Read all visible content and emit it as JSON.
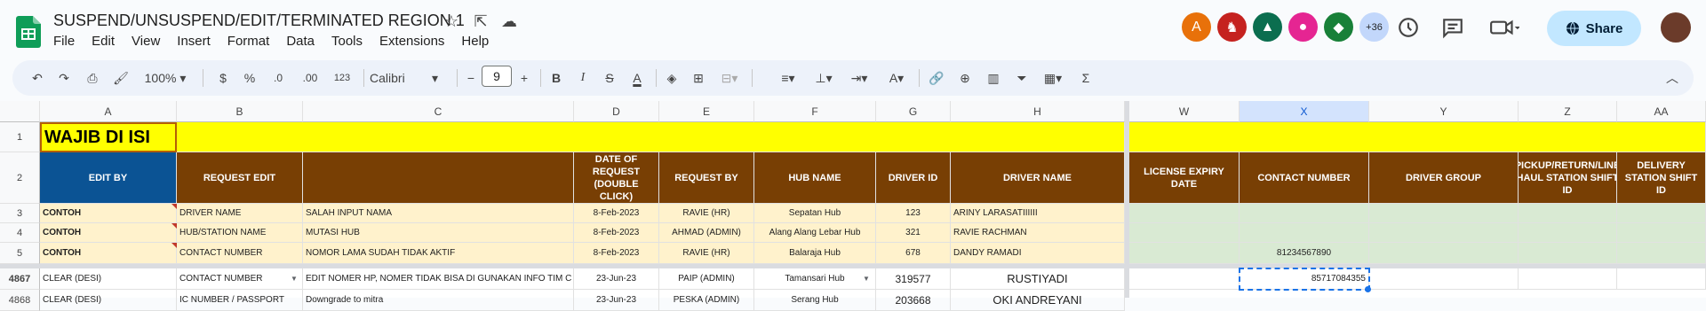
{
  "doc": {
    "title": "SUSPEND/UNSUSPEND/EDIT/TERMINATED REGION 1"
  },
  "menu": [
    "File",
    "Edit",
    "View",
    "Insert",
    "Format",
    "Data",
    "Tools",
    "Extensions",
    "Help"
  ],
  "collaborators": {
    "first_initial": "A",
    "more_count": "+36"
  },
  "share_label": "Share",
  "toolbar": {
    "zoom": "100%",
    "currency": "$",
    "percent": "%",
    "dec_decrease": ".0",
    "dec_increase": ".00",
    "number_format": "123",
    "font": "Calibri",
    "font_size": "9"
  },
  "columns": {
    "left": [
      "A",
      "B",
      "C",
      "D",
      "E",
      "F",
      "G",
      "H"
    ],
    "right": [
      "W",
      "X",
      "Y",
      "Z",
      "AA"
    ],
    "selected": "X"
  },
  "row_numbers": [
    "1",
    "2",
    "3",
    "4",
    "5",
    "4867",
    "4868"
  ],
  "row1": {
    "a": "WAJIB DI ISI"
  },
  "headers": {
    "a": "EDIT BY",
    "b": "REQUEST EDIT",
    "c": "",
    "d": "DATE OF REQUEST (DOUBLE CLICK)",
    "e": "REQUEST BY",
    "f": "HUB NAME",
    "g": "DRIVER ID",
    "h": "DRIVER NAME",
    "w": "LICENSE EXPIRY DATE",
    "x": "CONTACT NUMBER",
    "y": "DRIVER GROUP",
    "z": "PICKUP/RETURN/LINE HAUL STATION SHIFT ID",
    "aa": "DELIVERY STATION SHIFT ID"
  },
  "rows": [
    {
      "a": "CONTOH",
      "b": "DRIVER NAME",
      "c": "SALAH INPUT NAMA",
      "d": "8-Feb-2023",
      "e": "RAVIE (HR)",
      "f": "Sepatan Hub",
      "g": "123",
      "h": "ARINY LARASATIIIIII",
      "x": ""
    },
    {
      "a": "CONTOH",
      "b": "HUB/STATION NAME",
      "c": "MUTASI HUB",
      "d": "8-Feb-2023",
      "e": "AHMAD (ADMIN)",
      "f": "Alang Alang Lebar Hub",
      "g": "321",
      "h": "RAVIE RACHMAN",
      "x": ""
    },
    {
      "a": "CONTOH",
      "b": "CONTACT NUMBER",
      "c": "NOMOR LAMA SUDAH TIDAK AKTIF",
      "d": "8-Feb-2023",
      "e": "RAVIE (HR)",
      "f": "Balaraja Hub",
      "g": "678",
      "h": "DANDY RAMADI",
      "x": "81234567890"
    },
    {
      "a": "CLEAR (DESI)",
      "b": "CONTACT NUMBER",
      "c": "EDIT NOMER HP, NOMER TIDAK BISA DI GUNAKAN INFO TIM C",
      "d": "23-Jun-23",
      "e": "PAIP (ADMIN)",
      "f": "Tamansari Hub",
      "g": "319577",
      "h": "RUSTIYADI",
      "x": "85717084355"
    },
    {
      "a": "CLEAR (DESI)",
      "b": "IC NUMBER / PASSPORT",
      "c": "Downgrade to mitra",
      "d": "23-Jun-23",
      "e": "PESKA (ADMIN)",
      "f": "Serang Hub",
      "g": "203668",
      "h": "OKI ANDREYANI",
      "x": ""
    }
  ]
}
